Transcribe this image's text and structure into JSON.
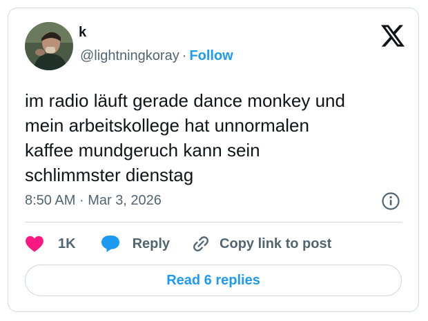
{
  "author": {
    "display_name": "k",
    "handle": "@lightningkoray",
    "separator": "·",
    "follow_label": "Follow"
  },
  "tweet": {
    "lines": [
      "im radio läuft gerade dance monkey und",
      "mein arbeitskollege hat unnormalen",
      "kaffee mundgeruch kann sein",
      "schlimmster dienstag"
    ],
    "time": "8:50 AM",
    "separator": "·",
    "date": "Mar 3, 2026"
  },
  "actions": {
    "like_count": "1K",
    "reply_label": "Reply",
    "copy_link_label": "Copy link to post"
  },
  "footer": {
    "read_replies_label": "Read 6 replies"
  },
  "colors": {
    "accent": "#1d9bf0",
    "like": "#f91880",
    "text_primary": "#0f1419",
    "text_secondary": "#536471",
    "border": "#cfd9de"
  },
  "icons": {
    "brand": "x-logo-icon",
    "info": "info-icon",
    "like": "heart-icon",
    "reply": "speech-bubble-icon",
    "copy_link": "link-icon"
  }
}
